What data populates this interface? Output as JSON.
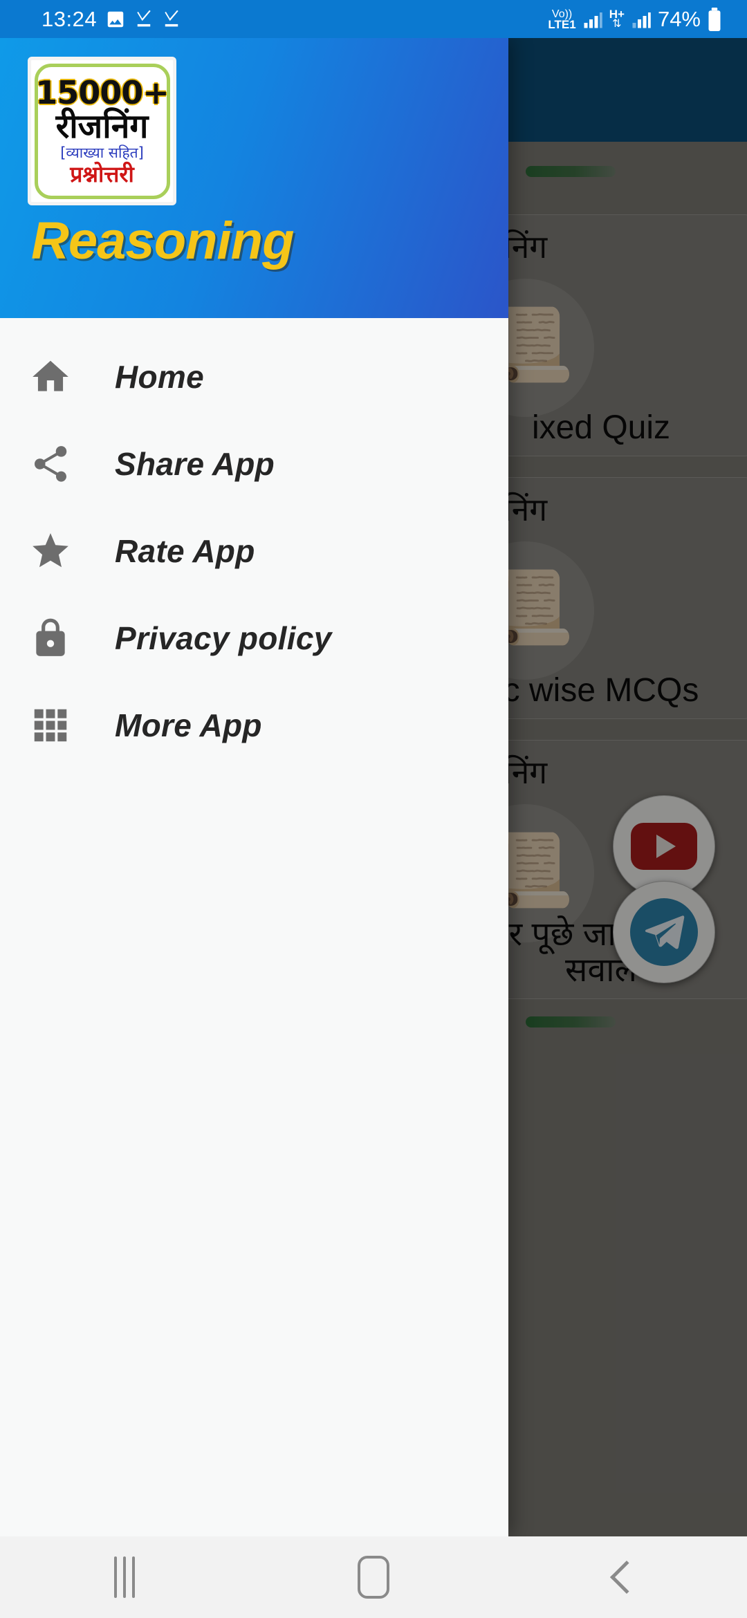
{
  "status_bar": {
    "time": "13:24",
    "battery": "74%",
    "network_label_top": "Vo))",
    "network_label_bottom": "LTE1",
    "data_label": "H+",
    "icons": [
      "image-icon",
      "check-download-icon",
      "check-download-icon",
      "volte-icon",
      "signal-bars-icon",
      "hspa-plus-icon",
      "signal-bars-icon",
      "battery-icon"
    ]
  },
  "drawer": {
    "logo": {
      "line1": "15000+",
      "line2": "रीजनिंग",
      "line3": "[व्याख्या सहित]",
      "line4": "प्रश्नोत्तरी"
    },
    "title": "Reasoning",
    "items": [
      {
        "label": "Home",
        "icon": "home-icon"
      },
      {
        "label": "Share App",
        "icon": "share-icon"
      },
      {
        "label": "Rate App",
        "icon": "star-icon"
      },
      {
        "label": "Privacy policy",
        "icon": "lock-icon"
      },
      {
        "label": "More App",
        "icon": "grid-apps-icon"
      }
    ]
  },
  "background": {
    "cards": [
      {
        "title": "रीजनिंग",
        "subtitle": "ixed Quiz",
        "image": "scroll-icon"
      },
      {
        "title": "रीजनिंग",
        "subtitle": "c wise MCQs",
        "image": "scroll-icon"
      },
      {
        "title": "रीजनिंग",
        "subtitle": "र पूछे जाने वाले\nसवाल",
        "image": "scroll-icon"
      }
    ],
    "fabs": [
      {
        "name": "youtube-fab",
        "label": "youtube-icon",
        "color": "#9e1b1b"
      },
      {
        "name": "telegram-fab",
        "label": "telegram-icon",
        "color": "#2a7ca3"
      }
    ],
    "accent_green": "#2c6636",
    "appbar_color": "#0b4a72"
  },
  "nav_bar": {
    "recents": "recents-icon",
    "home": "home-button-icon",
    "back": "back-icon"
  }
}
